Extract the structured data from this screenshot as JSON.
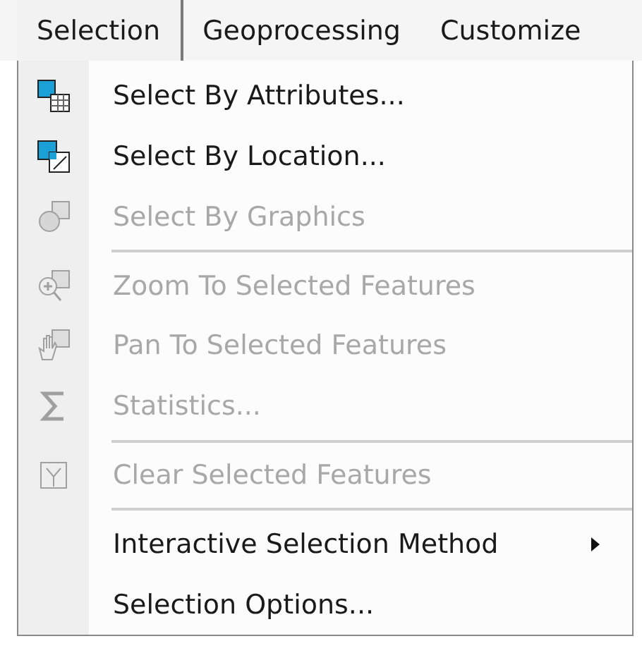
{
  "menubar": [
    {
      "label": "Selection",
      "selected": true
    },
    {
      "label": "Geoprocessing",
      "selected": false
    },
    {
      "label": "Customize",
      "selected": false
    }
  ],
  "menu": [
    {
      "kind": "item",
      "label": "Select By Attributes...",
      "disabled": false
    },
    {
      "kind": "item",
      "label": "Select By Location...",
      "disabled": false
    },
    {
      "kind": "item",
      "label": "Select By Graphics",
      "disabled": true
    },
    {
      "kind": "separator"
    },
    {
      "kind": "item",
      "label": "Zoom To Selected Features",
      "disabled": true
    },
    {
      "kind": "item",
      "label": "Pan To Selected Features",
      "disabled": true
    },
    {
      "kind": "item",
      "label": "Statistics...",
      "disabled": true
    },
    {
      "kind": "separator"
    },
    {
      "kind": "item",
      "label": "Clear Selected Features",
      "disabled": true
    },
    {
      "kind": "separator"
    },
    {
      "kind": "submenu",
      "label": "Interactive Selection Method",
      "disabled": false
    },
    {
      "kind": "item",
      "label": "Selection Options...",
      "disabled": false
    }
  ]
}
